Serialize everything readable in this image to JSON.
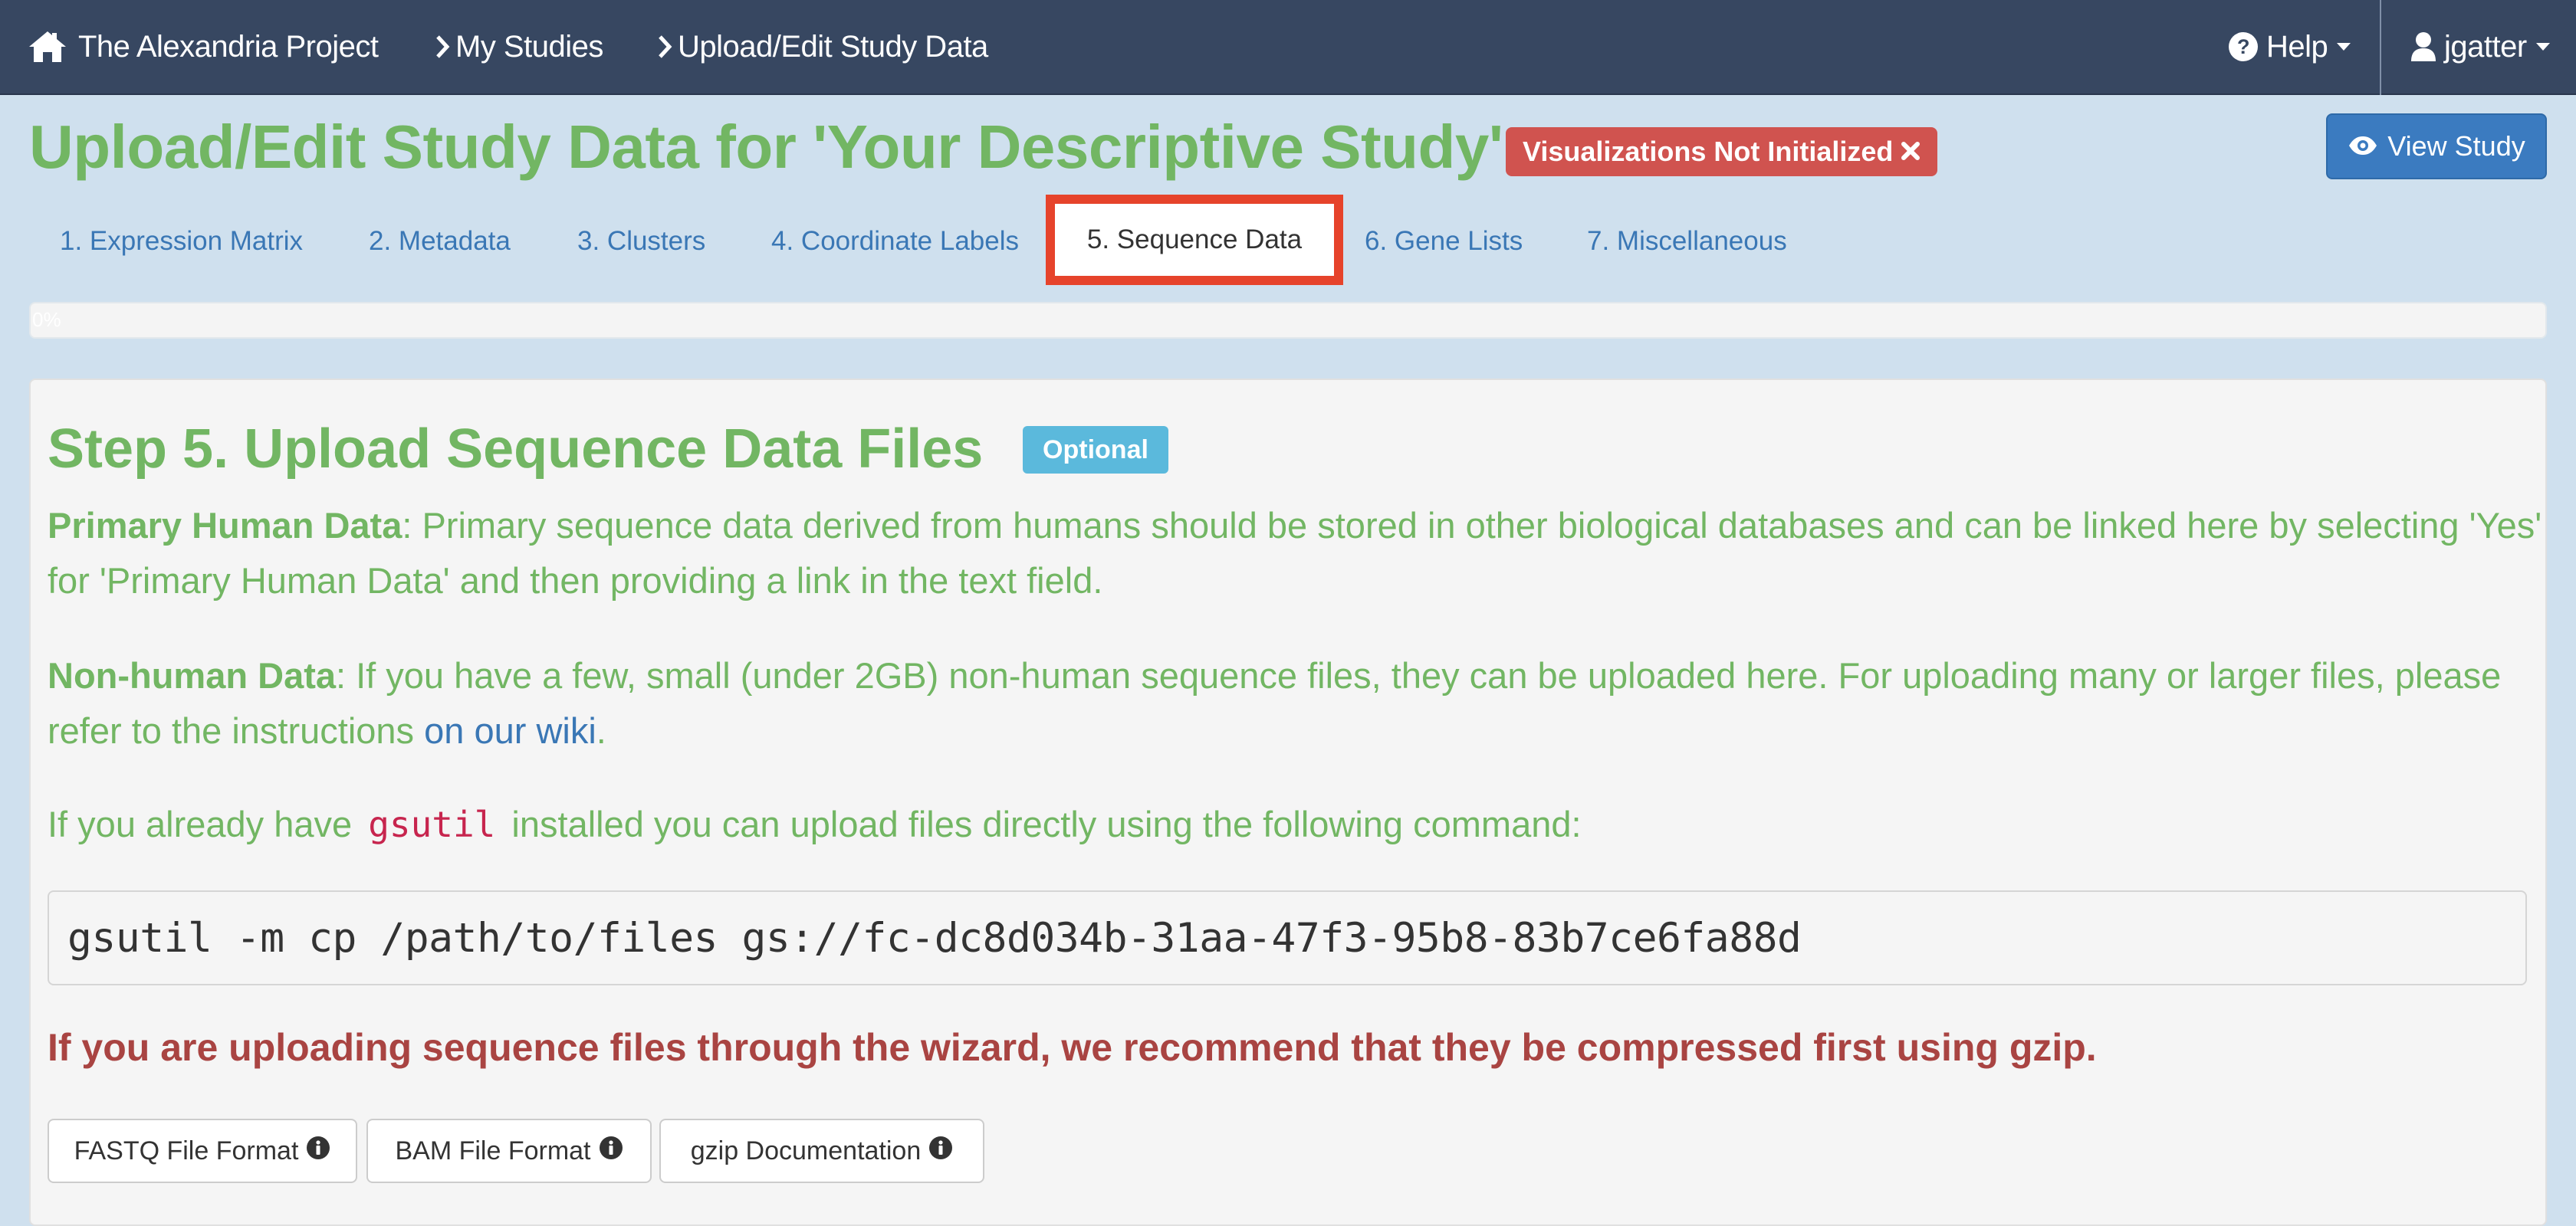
{
  "navbar": {
    "brand": "The Alexandria Project",
    "my_studies": "My Studies",
    "upload_edit": "Upload/Edit Study Data",
    "help": "Help",
    "user": "jgatter"
  },
  "header": {
    "title": "Upload/Edit Study Data for 'Your Descriptive Study'",
    "status_badge": "Visualizations Not Initialized",
    "view_study": "View Study"
  },
  "tabs": [
    {
      "label": "1. Expression Matrix"
    },
    {
      "label": "2. Metadata"
    },
    {
      "label": "3. Clusters"
    },
    {
      "label": "4. Coordinate Labels"
    },
    {
      "label": "5. Sequence Data",
      "active": true
    },
    {
      "label": "6. Gene Lists"
    },
    {
      "label": "7. Miscellaneous"
    }
  ],
  "progress": {
    "label": "0%",
    "value": 0
  },
  "step": {
    "title": "Step 5. Upload Sequence Data Files",
    "badge": "Optional",
    "primary_heading": "Primary Human Data",
    "primary_text": ": Primary sequence data derived from humans should be stored in other biological databases and can be linked here by selecting 'Yes' for 'Primary Human Data' and then providing a link in the text field.",
    "nonhuman_heading": "Non-human Data",
    "nonhuman_text": ": If you have a few, small (under 2GB) non-human sequence files, they can be uploaded here. For uploading many or larger files, please refer to the instructions ",
    "nonhuman_link": "on our wiki",
    "nonhuman_end": ".",
    "gsutil_pre": "If you already have ",
    "gsutil_code": "gsutil",
    "gsutil_post": " installed you can upload files directly using the following command:",
    "command": "gsutil -m cp /path/to/files gs://fc-dc8d034b-31aa-47f3-95b8-83b7ce6fa88d",
    "warning": "If you are uploading sequence files through the wizard, we recommend that they be compressed first using gzip."
  },
  "doc_buttons": [
    {
      "label": "FASTQ File Format"
    },
    {
      "label": "BAM File Format"
    },
    {
      "label": "gzip Documentation"
    }
  ],
  "colors": {
    "navbar": "#374761",
    "page_bg": "#cfe0ee",
    "title_green": "#72b663",
    "link_blue": "#3a77b5",
    "badge_red": "#d0534f",
    "highlight_red": "#e6432b",
    "warning_red": "#a94442",
    "optional_blue": "#5bb9dc"
  },
  "icons": [
    "home-icon",
    "chevron-right-icon",
    "question-circle-icon",
    "user-icon",
    "caret-down-icon",
    "close-icon",
    "eye-icon",
    "info-circle-icon"
  ]
}
